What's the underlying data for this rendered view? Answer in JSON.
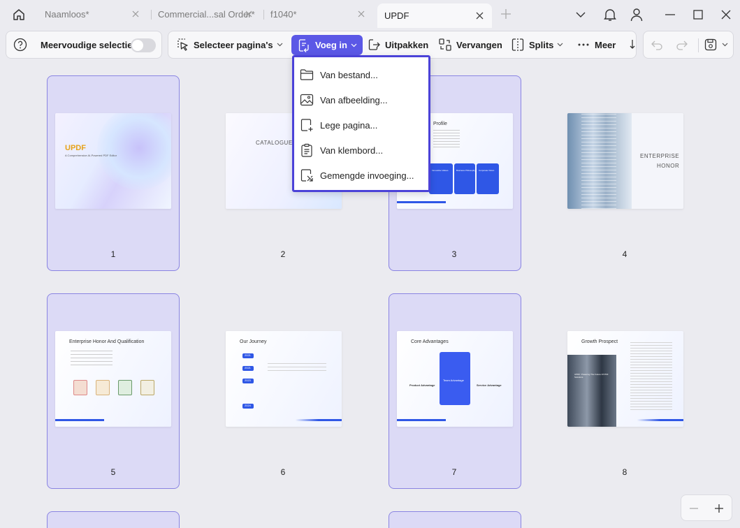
{
  "tabs": [
    {
      "label": "Naamloos*"
    },
    {
      "label": "Commercial...sal Order*"
    },
    {
      "label": "f1040*"
    },
    {
      "label": "UPDF"
    }
  ],
  "toolbar": {
    "multi_select": "Meervoudige selectie",
    "select_pages": "Selecteer pagina's",
    "insert": "Voeg in",
    "extract": "Uitpakken",
    "replace": "Vervangen",
    "split": "Splits",
    "more": "Meer"
  },
  "insert_menu": [
    {
      "label": "Van bestand...",
      "icon": "folder-icon"
    },
    {
      "label": "Van afbeelding...",
      "icon": "image-icon"
    },
    {
      "label": "Lege pagina...",
      "icon": "blank-page-icon"
    },
    {
      "label": "Van klembord...",
      "icon": "clipboard-icon"
    },
    {
      "label": "Gemengde invoeging...",
      "icon": "mixed-insert-icon"
    }
  ],
  "pages": [
    {
      "number": "1",
      "selected": true,
      "title": "UPDF",
      "subtitle": "A Comprehensive AI-Powered PDF Editor"
    },
    {
      "number": "2",
      "selected": false,
      "title": "CATALOGUE"
    },
    {
      "number": "3",
      "selected": true,
      "title": "Profile",
      "items": [
        "Innovative Values",
        "Business Philosophy",
        "Corporate Vision"
      ]
    },
    {
      "number": "4",
      "selected": false,
      "title": "ENTERPRISE",
      "title2": "HONOR"
    },
    {
      "number": "5",
      "selected": true,
      "title": "Enterprise Honor And Qualification"
    },
    {
      "number": "6",
      "selected": false,
      "title": "Our Journey",
      "years": [
        "2021",
        "2021",
        "2023",
        "2024"
      ]
    },
    {
      "number": "7",
      "selected": true,
      "title": "Core Advantages",
      "items": [
        "Product Advantage",
        "Team Advantage",
        "Service Advantage"
      ]
    },
    {
      "number": "8",
      "selected": false,
      "title": "Growth Prospect",
      "caption": "UPDF: Powering The Future Of PDF Solutions"
    }
  ],
  "colors": {
    "accent": "#5b58e6",
    "selection": "#dcdaf6",
    "menu_border": "#4b42d8"
  }
}
